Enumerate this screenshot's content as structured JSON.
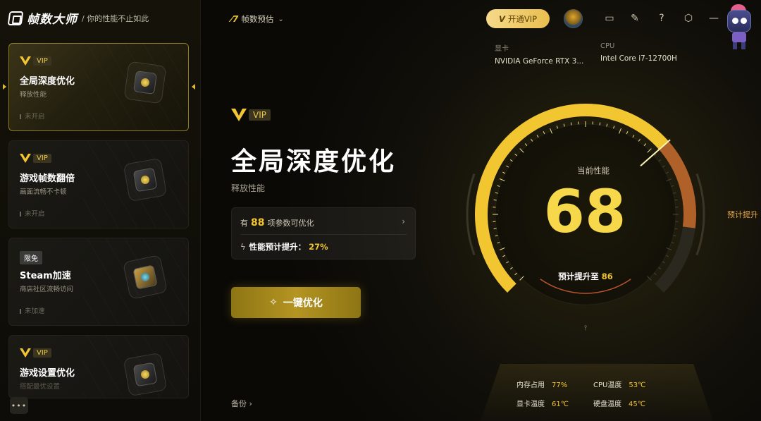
{
  "app": {
    "name": "帧数大师",
    "slogan": "/ 你的性能不止如此"
  },
  "sidebar": {
    "cards": [
      {
        "badge": "VIP",
        "badge_type": "vip",
        "title": "全局深度优化",
        "subtitle": "释放性能",
        "status": "未开启",
        "icon": "chip-icon",
        "active": true
      },
      {
        "badge": "VIP",
        "badge_type": "vip",
        "title": "游戏帧数翻倍",
        "subtitle": "画面流畅不卡顿",
        "status": "未开启",
        "icon": "layers-icon",
        "active": false
      },
      {
        "badge": "限免",
        "badge_type": "plain",
        "title": "Steam加速",
        "subtitle": "商店社区流畅访问",
        "status": "未加速",
        "icon": "rocket-icon",
        "active": false
      },
      {
        "badge": "VIP",
        "badge_type": "vip",
        "title": "游戏设置优化",
        "subtitle": "搭配最优设置",
        "status": "",
        "icon": "joystick-icon",
        "active": false
      }
    ],
    "more_label": "•••"
  },
  "topbar": {
    "predict_label": "帧数预估",
    "vip_button": "开通VIP",
    "icons": [
      "gift-icon",
      "edit-icon",
      "support-icon",
      "settings-icon",
      "minimize-icon"
    ]
  },
  "hardware": {
    "gpu_label": "显卡",
    "gpu_value": "NVIDIA GeForce RTX 3...",
    "cpu_label": "CPU",
    "cpu_value": "Intel Core i7-12700H"
  },
  "hero": {
    "badge": "VIP",
    "title": "全局深度优化",
    "subtitle": "释放性能",
    "params_prefix": "有",
    "params_count": "88",
    "params_suffix": "项参数可优化",
    "boost_label": "性能预计提升：",
    "boost_value": "27%",
    "optimize_button": "一键优化",
    "backup_label": "备份"
  },
  "gauge": {
    "label": "当前性能",
    "value": 68,
    "predicted": 86,
    "max": 100,
    "predict_prefix": "预计提升至",
    "side_tag": "预计提升"
  },
  "stats": {
    "mem_label": "内存占用",
    "mem_value": "77%",
    "cpu_temp_label": "CPU温度",
    "cpu_temp_value": "53℃",
    "gpu_temp_label": "显卡温度",
    "gpu_temp_value": "61℃",
    "disk_temp_label": "硬盘温度",
    "disk_temp_value": "45℃"
  },
  "colors": {
    "accent": "#f2c631",
    "vip_button": "#f0cd6b",
    "background": "#0a0906",
    "predict_arc": "#c86a2c"
  }
}
